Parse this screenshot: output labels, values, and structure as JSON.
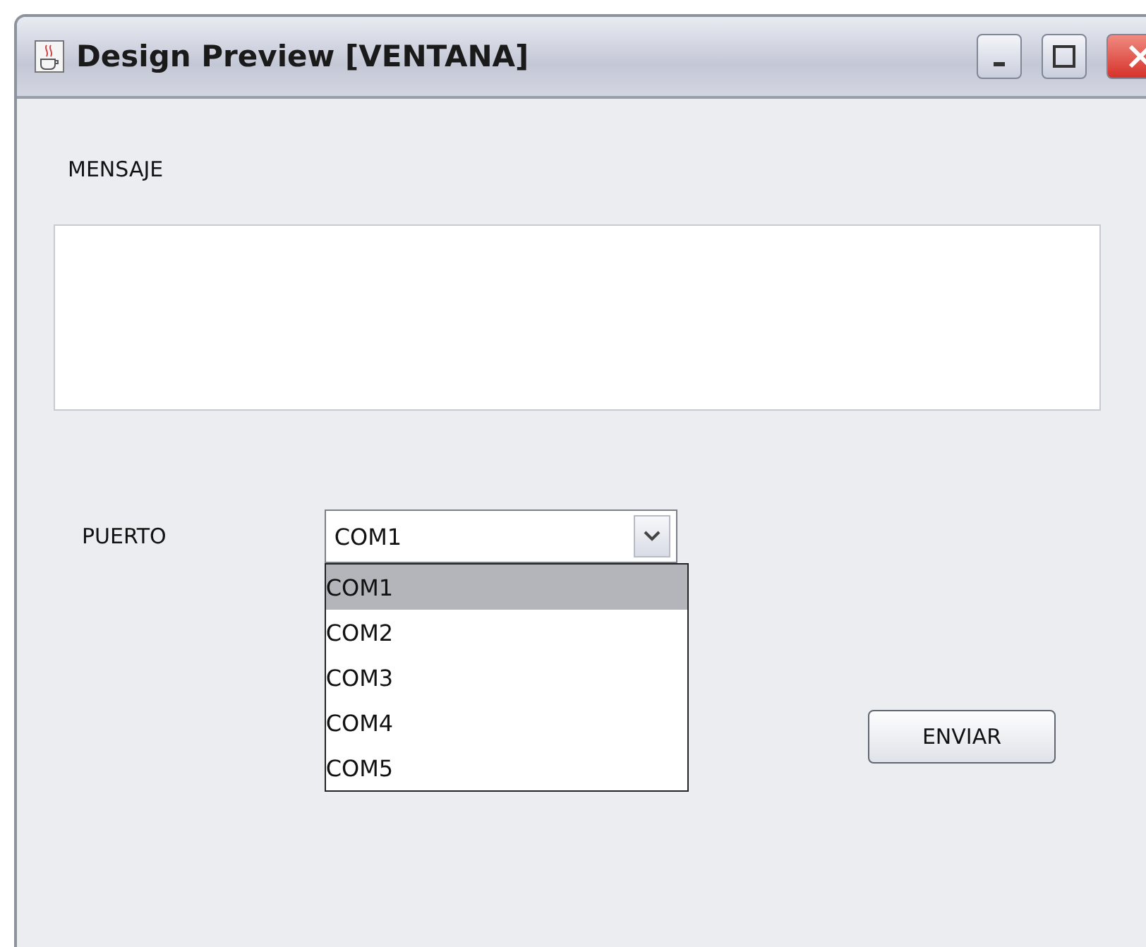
{
  "window": {
    "title": "Design Preview [VENTANA]"
  },
  "message": {
    "label": "MENSAJE"
  },
  "port": {
    "label": "PUERTO",
    "value": "COM1",
    "expanded": true,
    "options": [
      {
        "label": "COM1",
        "selected": true
      },
      {
        "label": "COM2",
        "selected": false
      },
      {
        "label": "COM3",
        "selected": false
      },
      {
        "label": "COM4",
        "selected": false
      },
      {
        "label": "COM5",
        "selected": false
      }
    ]
  },
  "buttons": [
    "ENVIAR"
  ]
}
